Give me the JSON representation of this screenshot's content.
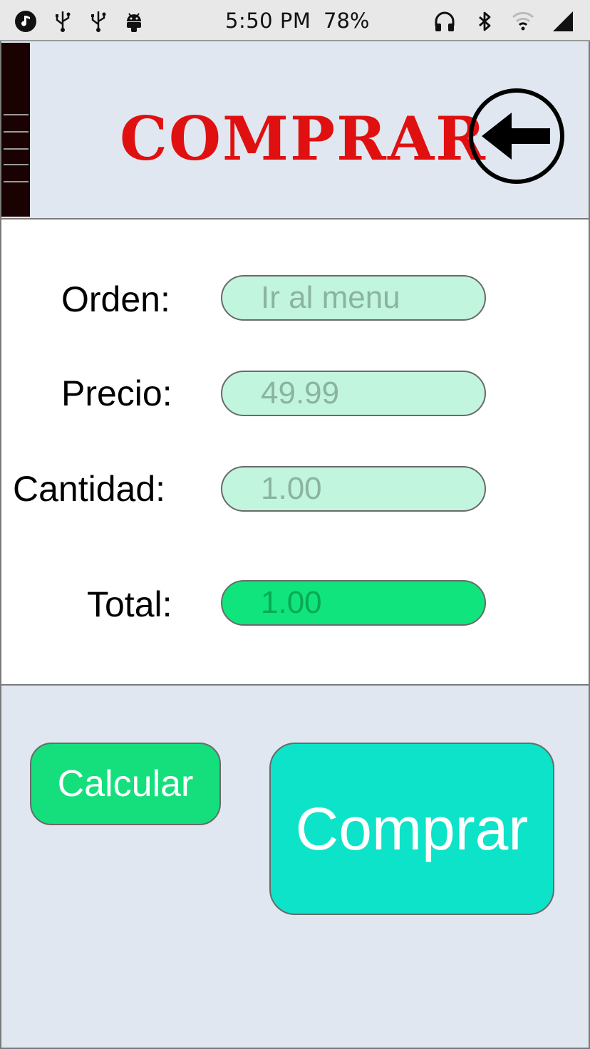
{
  "status_bar": {
    "time": "5:50 PM",
    "battery": "78%",
    "left_icons": [
      "music-icon",
      "usb-icon",
      "usb-icon",
      "android-icon"
    ],
    "right_icons": [
      "headphones-icon",
      "bluetooth-icon",
      "wifi-icon",
      "signal-icon"
    ]
  },
  "header": {
    "title": "COMPRAR",
    "back_icon": "arrow-left-circle-icon",
    "title_color": "#e01010"
  },
  "form": {
    "orden": {
      "label": "Orden:",
      "value": "Ir al menu"
    },
    "precio": {
      "label": "Precio:",
      "value": "49.99"
    },
    "cantidad": {
      "label": "Cantidad:",
      "value": "1.00"
    },
    "total": {
      "label": "Total:",
      "value": "1.00"
    }
  },
  "actions": {
    "calcular_label": "Calcular",
    "comprar_label": "Comprar"
  },
  "colors": {
    "header_bg": "#e0e7f0",
    "field_bg": "#c2f5de",
    "total_bg": "#0fe57c",
    "calcular_bg": "#15df7c",
    "comprar_bg": "#0de3c8"
  }
}
